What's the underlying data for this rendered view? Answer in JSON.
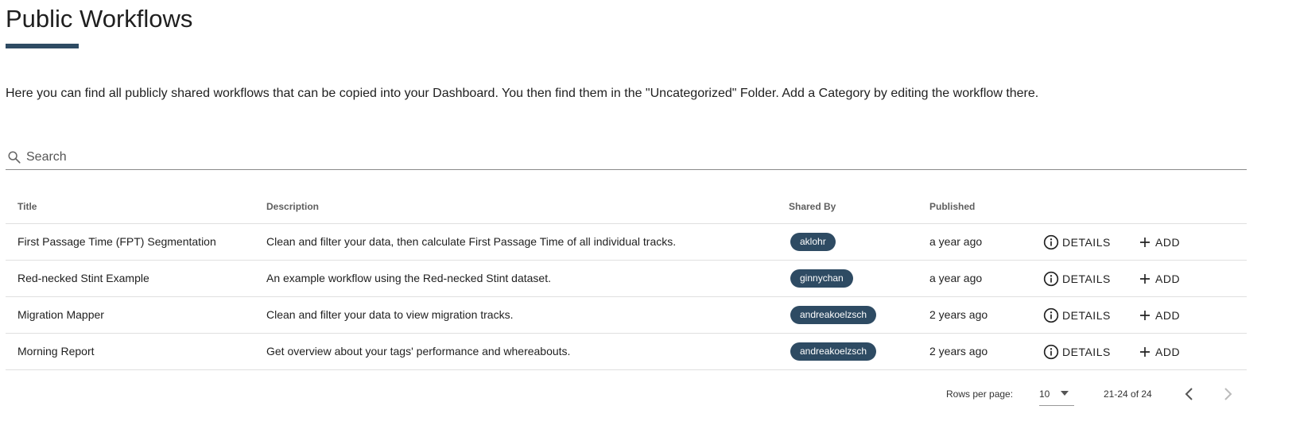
{
  "page": {
    "title": "Public Workflows",
    "intro": "Here you can find all publicly shared workflows that can be copied into your Dashboard. You then find them in the \"Uncategorized\" Folder. Add a Category by editing the workflow there.",
    "accent_color": "#2e4b63"
  },
  "search": {
    "placeholder": "Search",
    "value": "",
    "icon": "search-icon"
  },
  "table": {
    "headers": {
      "title": "Title",
      "description": "Description",
      "shared_by": "Shared By",
      "published": "Published"
    },
    "rows": [
      {
        "title": "First Passage Time (FPT) Segmentation",
        "description": "Clean and filter your data, then calculate First Passage Time of all individual tracks.",
        "shared_by": "aklohr",
        "published": "a year ago",
        "details_label": "DETAILS",
        "add_label": "ADD"
      },
      {
        "title": "Red-necked Stint Example",
        "description": "An example workflow using the Red-necked Stint dataset.",
        "shared_by": "ginnychan",
        "published": "a year ago",
        "details_label": "DETAILS",
        "add_label": "ADD"
      },
      {
        "title": "Migration Mapper",
        "description": "Clean and filter your data to view migration tracks.",
        "shared_by": "andreakoelzsch",
        "published": "2 years ago",
        "details_label": "DETAILS",
        "add_label": "ADD"
      },
      {
        "title": "Morning Report",
        "description": "Get overview about your tags' performance and whereabouts.",
        "shared_by": "andreakoelzsch",
        "published": "2 years ago",
        "details_label": "DETAILS",
        "add_label": "ADD"
      }
    ]
  },
  "pagination": {
    "rows_per_page_label": "Rows per page:",
    "rows_per_page_value": "10",
    "range": "21-24 of 24"
  }
}
